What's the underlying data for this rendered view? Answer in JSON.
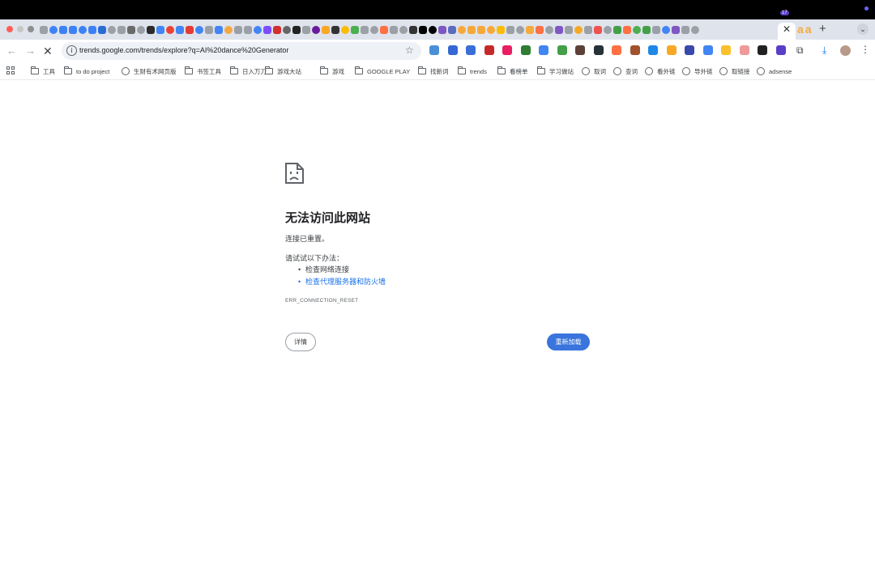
{
  "browser": {
    "tab_strip": {
      "active_tab_close": "✕",
      "extra_tab_glyphs": [
        "a",
        "a"
      ],
      "new_tab": "+",
      "tab_menu": "⌄",
      "favicon_colors": [
        "#9aa0a6",
        "#3c82f6",
        "#3c82f6",
        "#3c82f6",
        "#3c82f6",
        "#3c82f6",
        "#2a6bd6",
        "#9aa0a6",
        "#9aa0a6",
        "#6a6a6a",
        "#9aa0a6",
        "#2b2b2b",
        "#4285f4",
        "#ea4335",
        "#4285f4",
        "#e53935",
        "#4285f4",
        "#9aa0a6",
        "#4285f4",
        "#f4a742",
        "#9aa0a6",
        "#9aa0a6",
        "#4285f4",
        "#7c4dff",
        "#d32f2f",
        "#666",
        "#222",
        "#9aa0a6",
        "#6a1b9a",
        "#f9a825",
        "#333",
        "#fbbc05",
        "#4caf50",
        "#9aa0a6",
        "#9aa0a6",
        "#ff7043",
        "#9aa0a6",
        "#9aa0a6",
        "#333",
        "#000",
        "#000",
        "#7e57c2",
        "#5c6bc0",
        "#f6a93b",
        "#f6a93b",
        "#f6a93b",
        "#f6a93b",
        "#fbbc05",
        "#9aa0a6",
        "#9aa0a6",
        "#f6a93b",
        "#ff7043",
        "#9aa0a6",
        "#7e57c2",
        "#9aa0a6",
        "#f9a825",
        "#9aa0a6",
        "#ef5350",
        "#9aa0a6",
        "#43a047",
        "#ff7043",
        "#4caf50",
        "#43a047",
        "#9aa0a6",
        "#4285f4",
        "#7e57c2",
        "#9aa0a6",
        "#9aa0a6"
      ]
    },
    "toolbar": {
      "back": "←",
      "forward": "→",
      "stop": "✕",
      "url": "trends.google.com/trends/explore?q=AI%20dance%20Generator",
      "star": "☆",
      "extension_badge": "17",
      "extension_colors": [
        "#4a90d9",
        "#3568d4",
        "#3b6fd8",
        "#c62828",
        "#e91e63",
        "#2e7d32",
        "#4285f4",
        "#43a047",
        "#5d4037",
        "#263238",
        "#ff7043",
        "#a0522d",
        "#1e88e5",
        "#f9a825",
        "#3949ab",
        "#4285f4",
        "#fbc02d",
        "#ef9a9a",
        "#222",
        "#5b3ec7"
      ],
      "puzzle": "⧉",
      "download": "⤓",
      "menu": "⋮"
    },
    "bookmarks": [
      {
        "type": "folder",
        "label": "工具"
      },
      {
        "type": "folder",
        "label": "to do project"
      },
      {
        "type": "site",
        "label": "生财有术网页版"
      },
      {
        "type": "folder",
        "label": "书签工具"
      },
      {
        "type": "folder",
        "label": "日入万刀"
      },
      {
        "type": "folder",
        "label": "游戏大站"
      },
      {
        "type": "folder",
        "label": "游戏"
      },
      {
        "type": "folder",
        "label": "GOOGLE PLAY"
      },
      {
        "type": "folder",
        "label": "找新词"
      },
      {
        "type": "folder",
        "label": "trends"
      },
      {
        "type": "folder",
        "label": "看榜单"
      },
      {
        "type": "folder",
        "label": "学习做站"
      },
      {
        "type": "site",
        "label": "取词"
      },
      {
        "type": "site",
        "label": "查词"
      },
      {
        "type": "site",
        "label": "看外链"
      },
      {
        "type": "site",
        "label": "导外链"
      },
      {
        "type": "site",
        "label": "取链接"
      },
      {
        "type": "site",
        "label": "adsense"
      }
    ]
  },
  "error_page": {
    "title": "无法访问此网站",
    "detail": "连接已重置。",
    "try_heading": "请试试以下办法：",
    "suggestions": [
      "检查网络连接",
      "检查代理服务器和防火墙"
    ],
    "error_code": "ERR_CONNECTION_RESET",
    "details_button": "详情",
    "reload_button": "重新加载"
  }
}
